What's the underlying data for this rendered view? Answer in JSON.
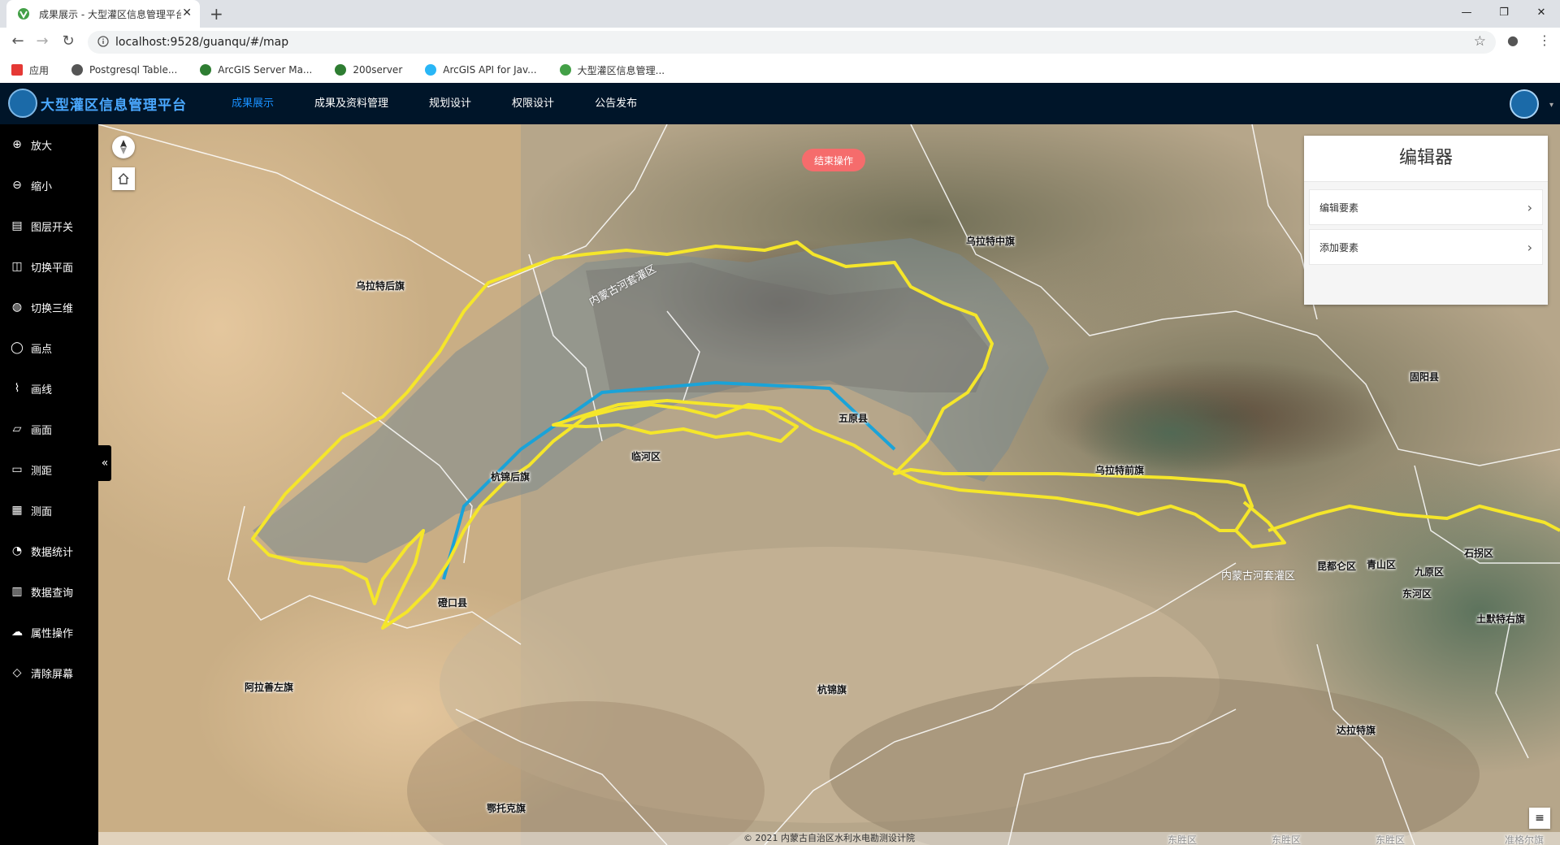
{
  "browser": {
    "tab_title": "成果展示 - 大型灌区信息管理平台",
    "tab_close": "✕",
    "new_tab": "+",
    "url": "localhost:9528/guanqu/#/map",
    "window_minimize": "—",
    "window_restore": "❐",
    "window_close": "✕",
    "bookmarks": [
      {
        "label": "应用",
        "color": "#e53935"
      },
      {
        "label": "Postgresql Table...",
        "color": "#555555"
      },
      {
        "label": "ArcGIS Server Ma...",
        "color": "#2e7d32"
      },
      {
        "label": "200server",
        "color": "#2e7d32"
      },
      {
        "label": "ArcGIS API for Jav...",
        "color": "#29b6f6"
      },
      {
        "label": "大型灌区信息管理...",
        "color": "#43a047"
      }
    ]
  },
  "app": {
    "title": "大型灌区信息管理平台",
    "menu": [
      {
        "label": "成果展示",
        "active": true
      },
      {
        "label": "成果及资料管理",
        "active": false
      },
      {
        "label": "规划设计",
        "active": false
      },
      {
        "label": "权限设计",
        "active": false
      },
      {
        "label": "公告发布",
        "active": false
      }
    ],
    "avatar_caret": "▾"
  },
  "sidebar": {
    "items": [
      {
        "label": "放大",
        "icon": "zoom-in-icon",
        "glyph": "⊕"
      },
      {
        "label": "缩小",
        "icon": "zoom-out-icon",
        "glyph": "⊖"
      },
      {
        "label": "图层开关",
        "icon": "layers-icon",
        "glyph": "▤"
      },
      {
        "label": "切换平面",
        "icon": "2d-map-icon",
        "glyph": "◫"
      },
      {
        "label": "切换三维",
        "icon": "globe-icon",
        "glyph": "◍"
      },
      {
        "label": "画点",
        "icon": "point-icon",
        "glyph": "◯"
      },
      {
        "label": "画线",
        "icon": "polyline-icon",
        "glyph": "⌇"
      },
      {
        "label": "画面",
        "icon": "polygon-icon",
        "glyph": "▱"
      },
      {
        "label": "测距",
        "icon": "ruler-icon",
        "glyph": "▭"
      },
      {
        "label": "测面",
        "icon": "area-measure-icon",
        "glyph": "▦"
      },
      {
        "label": "数据统计",
        "icon": "statistics-icon",
        "glyph": "◔"
      },
      {
        "label": "数据查询",
        "icon": "bar-chart-icon",
        "glyph": "▥"
      },
      {
        "label": "属性操作",
        "icon": "cloud-upload-icon",
        "glyph": "☁"
      },
      {
        "label": "清除屏幕",
        "icon": "eraser-icon",
        "glyph": "◇"
      }
    ]
  },
  "map": {
    "end_button": "结束操作",
    "collapse_glyph": "«",
    "attribution": "© 2021 内蒙古自治区水利水电勘测设计院",
    "list_glyph": "≡",
    "editor": {
      "title": "编辑器",
      "rows": [
        {
          "label": "编辑要素",
          "chev": "›"
        },
        {
          "label": "添加要素",
          "chev": "›"
        }
      ]
    },
    "labels": [
      {
        "text": "乌拉特中旗"
      },
      {
        "text": "乌拉特后旗"
      },
      {
        "text": "五原县"
      },
      {
        "text": "临河区"
      },
      {
        "text": "杭锦后旗"
      },
      {
        "text": "乌拉特前旗"
      },
      {
        "text": "固阳县"
      },
      {
        "text": "磴口县"
      },
      {
        "text": "石拐区"
      },
      {
        "text": "昆都仑区"
      },
      {
        "text": "青山区"
      },
      {
        "text": "九原区"
      },
      {
        "text": "东河区"
      },
      {
        "text": "土默特右旗"
      },
      {
        "text": "阿拉善左旗"
      },
      {
        "text": "杭锦旗"
      },
      {
        "text": "达拉特旗"
      },
      {
        "text": "鄂托克旗"
      },
      {
        "text": "东胜区"
      },
      {
        "text": "东胜区"
      },
      {
        "text": "东胜区"
      },
      {
        "text": "准格尔旗"
      },
      {
        "text": "内蒙古河套灌区"
      },
      {
        "text": "内蒙古河套灌区"
      }
    ]
  }
}
